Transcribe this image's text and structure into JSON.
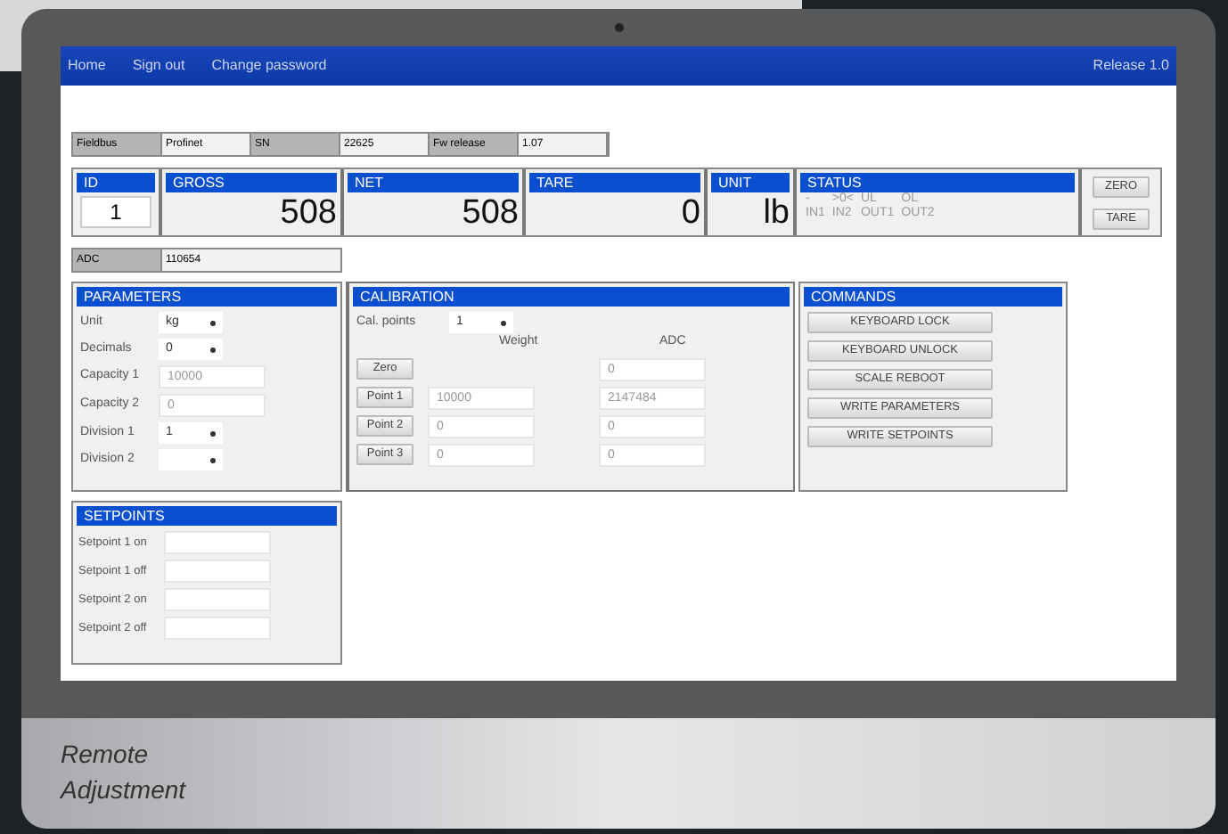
{
  "nav": {
    "items": [
      "Home",
      "Sign out",
      "Change password"
    ],
    "release": "Release 1.0"
  },
  "info": [
    {
      "label": "Fieldbus",
      "value": "Profinet"
    },
    {
      "label": "SN",
      "value": "22625"
    },
    {
      "label": "Fw release",
      "value": "1.07"
    }
  ],
  "readouts": [
    {
      "kind": "id",
      "label": "ID",
      "value": "1"
    },
    {
      "kind": "number",
      "label": "GROSS",
      "value": "508"
    },
    {
      "kind": "number",
      "label": "NET",
      "value": "508"
    },
    {
      "kind": "number",
      "label": "TARE",
      "value": "0"
    },
    {
      "kind": "unit",
      "label": "UNIT",
      "value": "lb"
    }
  ],
  "status": {
    "label": "STATUS",
    "indicators": [
      "-",
      ">0<",
      "UL",
      "OL",
      "IN1",
      "IN2",
      "OUT1",
      "OUT2"
    ]
  },
  "scale_buttons": [
    "ZERO",
    "TARE"
  ],
  "adc": {
    "label": "ADC",
    "value": "110654"
  },
  "parameters": {
    "title": "PARAMETERS",
    "rows": [
      {
        "kind": "select",
        "label": "Unit",
        "value": "kg"
      },
      {
        "kind": "select",
        "label": "Decimals",
        "value": "0"
      },
      {
        "kind": "input",
        "label": "Capacity 1",
        "value": "10000"
      },
      {
        "kind": "input",
        "label": "Capacity 2",
        "value": "0"
      },
      {
        "kind": "select",
        "label": "Division 1",
        "value": "1"
      },
      {
        "kind": "select",
        "label": "Division 2"
      }
    ]
  },
  "calibration": {
    "title": "CALIBRATION",
    "cal_points_label": "Cal. points",
    "cal_points_value": "1",
    "columns": [
      "Weight",
      "ADC"
    ],
    "rows": [
      {
        "button": "Zero",
        "adc": "0"
      },
      {
        "button": "Point 1",
        "weight": "10000",
        "adc": "2147484"
      },
      {
        "button": "Point 2",
        "weight": "0",
        "adc": "0"
      },
      {
        "button": "Point 3",
        "weight": "0",
        "adc": "0"
      }
    ]
  },
  "commands": {
    "title": "COMMANDS",
    "buttons": [
      "KEYBOARD LOCK",
      "KEYBOARD UNLOCK",
      "SCALE REBOOT",
      "WRITE PARAMETERS",
      "WRITE SETPOINTS"
    ]
  },
  "setpoints": {
    "title": "SETPOINTS",
    "rows": [
      {
        "label": "Setpoint 1 on"
      },
      {
        "label": "Setpoint 1 off"
      },
      {
        "label": "Setpoint 2 on"
      },
      {
        "label": "Setpoint 2 off"
      }
    ]
  },
  "caption": [
    "Remote",
    "Adjustment"
  ]
}
